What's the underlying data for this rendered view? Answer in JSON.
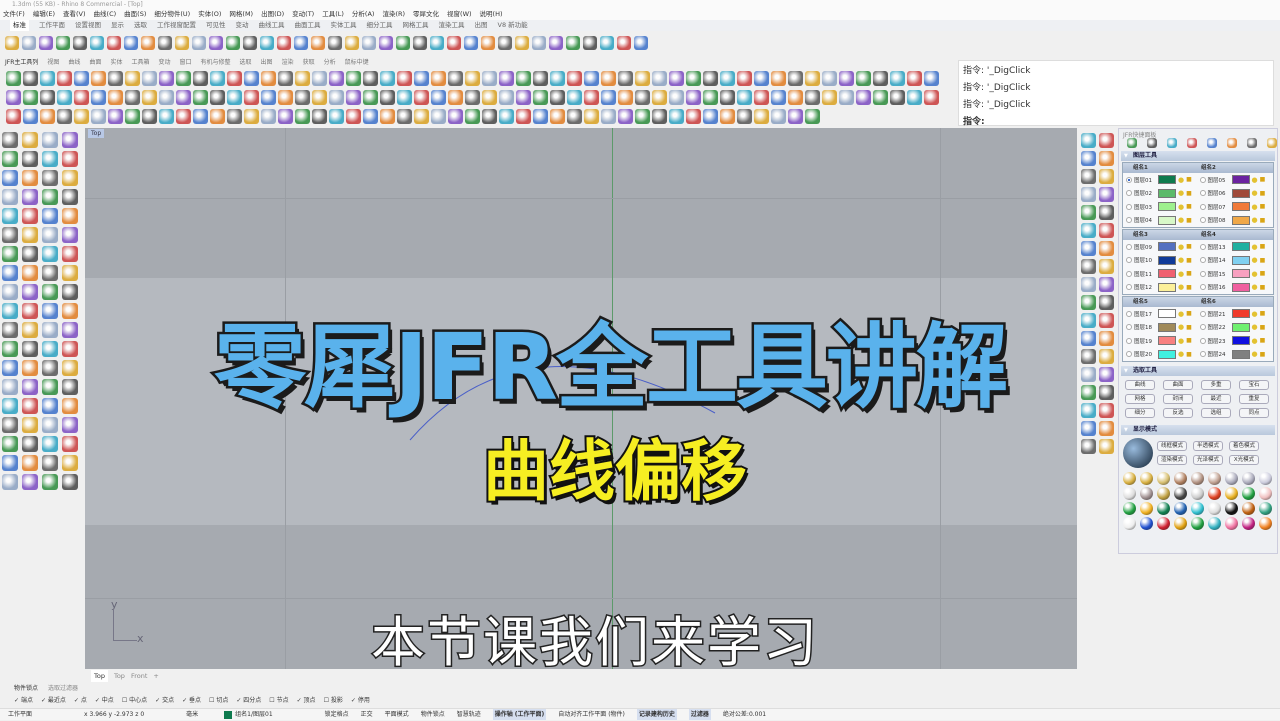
{
  "window": {
    "title": "1.3dm (55 KB) - Rhino 8 Commercial - [Top]"
  },
  "menu": [
    "文件(F)",
    "编辑(E)",
    "查看(V)",
    "曲线(C)",
    "曲面(S)",
    "细分物件(U)",
    "实体(O)",
    "网格(M)",
    "出图(D)",
    "变动(T)",
    "工具(L)",
    "分析(A)",
    "渲染(R)",
    "零犀文化",
    "视窗(W)",
    "说明(H)"
  ],
  "toolbar_tabs": [
    "标准",
    "工作平面",
    "设置视图",
    "显示",
    "选取",
    "工作视窗配置",
    "可见性",
    "变动",
    "曲线工具",
    "曲面工具",
    "实体工具",
    "细分工具",
    "网格工具",
    "渲染工具",
    "出图",
    "V8 新功能"
  ],
  "jfr_tabs": [
    "JFR主工具列",
    "视图",
    "曲线",
    "曲面",
    "实体",
    "工具箱",
    "变动",
    "窗口",
    "有机与修整",
    "选取",
    "出图",
    "渲染",
    "获取",
    "分析",
    "鼠标中键"
  ],
  "command": {
    "lines": [
      "指令: '_DigClick",
      "指令: '_DigClick",
      "指令: '_DigClick"
    ],
    "prompt": "指令:"
  },
  "viewport": {
    "name": "Top",
    "axis_x": "x",
    "axis_y": "y",
    "tabs": [
      "Top",
      "Top",
      "Front",
      "+"
    ]
  },
  "overlay": {
    "title": "零犀JFR全工具讲解",
    "subtitle": "曲线偏移",
    "caption": "本节课我们来学习"
  },
  "panel": {
    "title": "JFR快捷面板",
    "layer_tools": "图层工具",
    "groups": [
      {
        "names": [
          "组名1",
          "组名2"
        ],
        "layers": [
          [
            "图层01",
            "#0e7a4e"
          ],
          [
            "图层05",
            "#6b22a0"
          ],
          [
            "图层02",
            "#5cba6a"
          ],
          [
            "图层06",
            "#a04a3a"
          ],
          [
            "图层03",
            "#9ef08e"
          ],
          [
            "图层07",
            "#f07a3a"
          ],
          [
            "图层04",
            "#d8f8c8"
          ],
          [
            "图层08",
            "#f0a848"
          ]
        ]
      },
      {
        "names": [
          "组名3",
          "组名4"
        ],
        "layers": [
          [
            "图层09",
            "#5470c0"
          ],
          [
            "图层13",
            "#20b0a0"
          ],
          [
            "图层10",
            "#103a98"
          ],
          [
            "图层14",
            "#80d0f0"
          ],
          [
            "图层11",
            "#f06070"
          ],
          [
            "图层15",
            "#f8a0c0"
          ],
          [
            "图层12",
            "#fcf09a"
          ],
          [
            "图层16",
            "#f060a0"
          ]
        ]
      },
      {
        "names": [
          "组名5",
          "组名6"
        ],
        "layers": [
          [
            "图层17",
            "#ffffff"
          ],
          [
            "图层21",
            "#f03a2a"
          ],
          [
            "图层18",
            "#a08a5a"
          ],
          [
            "图层22",
            "#70f070"
          ],
          [
            "图层19",
            "#f88080"
          ],
          [
            "图层23",
            "#1010e0"
          ],
          [
            "图层20",
            "#40f0e0"
          ],
          [
            "图层24",
            "#808080"
          ]
        ]
      }
    ],
    "select_tools": {
      "title": "选取工具",
      "buttons": [
        "曲线",
        "曲面",
        "多重",
        "宝石",
        "网格",
        "封闭",
        "最近",
        "重复",
        "细分",
        "反选",
        "选组",
        "同点"
      ]
    },
    "display_mode": {
      "title": "显示模式",
      "buttons": [
        "线框模式",
        "半透模式",
        "着色模式",
        "渲染模式",
        "光泽模式",
        "X光模式"
      ]
    }
  },
  "osnap": {
    "tabs": [
      "物件锁点",
      "选取过滤器"
    ],
    "items": [
      "端点",
      "最近点",
      "点",
      "中点",
      "中心点",
      "交点",
      "垂点",
      "切点",
      "四分点",
      "节点",
      "顶点",
      "投影",
      "停用"
    ],
    "checked": [
      true,
      true,
      true,
      true,
      false,
      true,
      true,
      false,
      true,
      false,
      true,
      false,
      true
    ]
  },
  "status": {
    "cplane": "工作平面",
    "coords": "x 3.966  y -2.973  z 0",
    "unit": "毫米",
    "layer": "组名1/图层01",
    "layer_color": "#0e7a4e",
    "items": [
      "锁定格点",
      "正交",
      "平面模式",
      "物件锁点",
      "智慧轨迹"
    ],
    "gumball": "操作轴 (工作平面)",
    "autoalign": "自动对齐工作平面 (物件)",
    "history": "记录建构历史",
    "filter": "过滤器",
    "tolerance": "绝对公差:0.001"
  }
}
